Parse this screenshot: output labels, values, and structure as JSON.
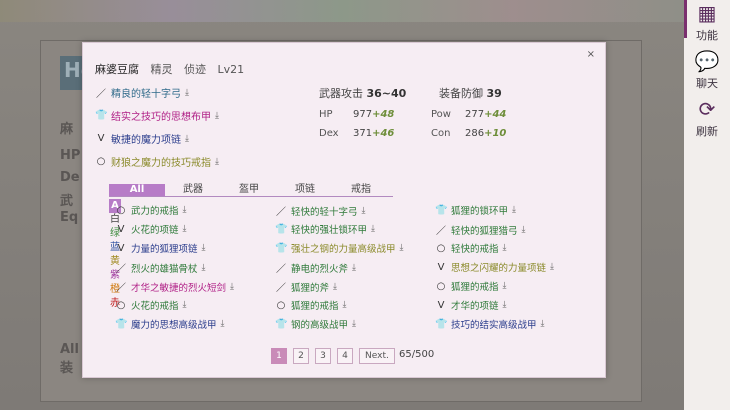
{
  "background": {
    "ghost_title": "He",
    "ghost_text": [
      "麻",
      "HP",
      "De",
      "武",
      "Eq",
      "All",
      "装"
    ]
  },
  "rail": [
    {
      "icon": "grid-icon",
      "glyph": "▦",
      "label": "功能"
    },
    {
      "icon": "chat-icon",
      "glyph": "💬",
      "label": "聊天"
    },
    {
      "icon": "refresh-icon",
      "glyph": "⟳",
      "label": "刷新"
    }
  ],
  "modal": {
    "close": "×",
    "name": "麻婆豆腐",
    "race": "精灵",
    "cls": "侦迹",
    "level": "Lv21",
    "equipped": [
      {
        "icon": "／",
        "text": "精良的轻十字弓",
        "color": "#2f6a8a"
      },
      {
        "icon": "👕",
        "text": "结实之技巧的思想布甲",
        "color": "#b01f86"
      },
      {
        "icon": "Ⅴ",
        "text": "敏捷的魔力项链",
        "color": "#2b3d8c"
      },
      {
        "icon": "○",
        "text": "财狼之魔力的技巧戒指",
        "color": "#8a8a2a"
      }
    ],
    "weapon_attack_label": "武器攻击",
    "weapon_attack": "36~40",
    "armor_def_label": "装备防御",
    "armor_def": "39",
    "stats": [
      {
        "k": "HP",
        "v": "977",
        "b": "+48"
      },
      {
        "k": "Pow",
        "v": "277",
        "b": "+44"
      },
      {
        "k": "Dex",
        "v": "371",
        "b": "+46"
      },
      {
        "k": "Con",
        "v": "286",
        "b": "+10"
      }
    ],
    "tabs": [
      "All",
      "武器",
      "盔甲",
      "项链",
      "戒指"
    ],
    "filters": [
      {
        "t": "A",
        "c": "#ffffff"
      },
      {
        "t": "白",
        "c": "#444"
      },
      {
        "t": "绿",
        "c": "#3a8a3a"
      },
      {
        "t": "蓝",
        "c": "#2a4fa0"
      },
      {
        "t": "黄",
        "c": "#a08a20"
      },
      {
        "t": "紫",
        "c": "#a03aa0"
      },
      {
        "t": "橙",
        "c": "#d07a10"
      },
      {
        "t": "赤",
        "c": "#c02020"
      }
    ],
    "items": [
      [
        {
          "i": "○",
          "t": "武力的戒指",
          "c": "#2f7a3a"
        },
        {
          "i": "Ⅴ",
          "t": "火花的项链",
          "c": "#2f7a3a"
        },
        {
          "i": "Ⅴ",
          "t": "力量的狐狸项链",
          "c": "#2b3d8c"
        },
        {
          "i": "／",
          "t": "烈火的雄猫骨杖",
          "c": "#2f7a3a"
        },
        {
          "i": "／",
          "t": "才华之敏捷的烈火短剑",
          "c": "#b01f86"
        },
        {
          "i": "○",
          "t": "火花的戒指",
          "c": "#2f7a3a"
        },
        {
          "i": "👕",
          "t": "魔力的思想高级战甲",
          "c": "#2b3d8c"
        }
      ],
      [
        {
          "i": "／",
          "t": "轻快的轻十字弓",
          "c": "#2f7a3a"
        },
        {
          "i": "👕",
          "t": "轻快的强壮锁环甲",
          "c": "#2f7a3a"
        },
        {
          "i": "👕",
          "t": "强壮之钢的力量高级战甲",
          "c": "#8a8a2a"
        },
        {
          "i": "／",
          "t": "静电的烈火斧",
          "c": "#2f7a3a"
        },
        {
          "i": "／",
          "t": "狐狸的斧",
          "c": "#2f7a3a"
        },
        {
          "i": "○",
          "t": "狐狸的戒指",
          "c": "#2f7a3a"
        },
        {
          "i": "👕",
          "t": "钢的高级战甲",
          "c": "#2f7a3a"
        }
      ],
      [
        {
          "i": "👕",
          "t": "狐狸的锁环甲",
          "c": "#2f7a3a"
        },
        {
          "i": "／",
          "t": "轻快的狐狸猎弓",
          "c": "#2f7a3a"
        },
        {
          "i": "○",
          "t": "轻快的戒指",
          "c": "#2f7a3a"
        },
        {
          "i": "Ⅴ",
          "t": "思想之闪耀的力量项链",
          "c": "#8a8a2a"
        },
        {
          "i": "○",
          "t": "狐狸的戒指",
          "c": "#2f7a3a"
        },
        {
          "i": "Ⅴ",
          "t": "才华的项链",
          "c": "#2f7a3a"
        },
        {
          "i": "👕",
          "t": "技巧的结实高级战甲",
          "c": "#2b3d8c"
        }
      ]
    ],
    "pages": [
      "1",
      "2",
      "3",
      "4"
    ],
    "next": "Next.",
    "count": "65/500"
  }
}
